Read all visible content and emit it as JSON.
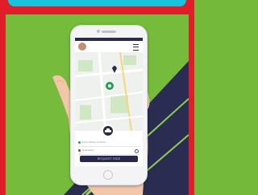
{
  "app": {
    "header": {
      "avatar": "avatar",
      "menu_icon": "hamburger-menu-icon"
    },
    "map": {
      "pins": [
        "pickup-pin-icon",
        "car-location-icon"
      ]
    },
    "sheet": {
      "pickup_placeholder": "Enter Pickup Location",
      "dropoff_placeholder": "Destination",
      "cta_label": "REQUEST RIDE"
    }
  },
  "colors": {
    "background_green": "#74b93a",
    "frame_red": "#e01d28",
    "top_cyan": "#19c3dd",
    "navy": "#27284a"
  }
}
